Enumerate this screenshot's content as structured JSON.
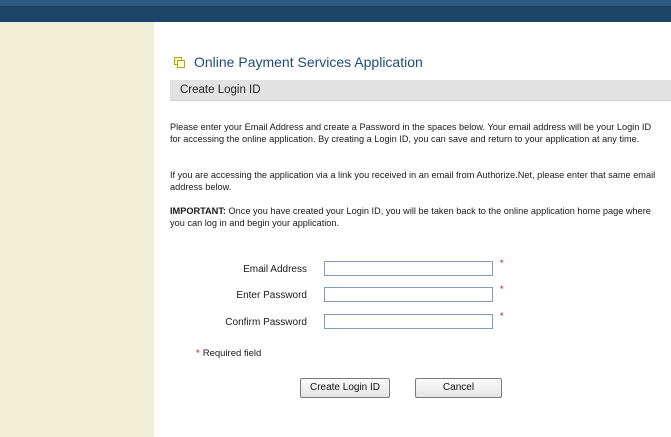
{
  "colors": {
    "top_bar": "#1c4468",
    "sidebar": "#f0efd6",
    "title": "#1f4d78",
    "section_bar": "#e2e2e2",
    "required_star": "#d40000"
  },
  "header": {
    "title": "Online Payment Services Application",
    "icon": "document-copy-icon"
  },
  "section": {
    "title": "Create Login ID"
  },
  "instructions": {
    "para1": "Please enter your Email Address and create a Password in the spaces below. Your email address will be your Login ID for accessing the online application. By creating a Login ID, you can save and return to your application at any time.",
    "para2": "If you are accessing the application via a link you received in an email from Authorize.Net, please enter that same email address below.",
    "para3_bold": "IMPORTANT:",
    "para3_rest": " Once you have created your Login ID, you will be taken back to the online application home page where you can log in and begin your application."
  },
  "form": {
    "fields": [
      {
        "label": "Email Address",
        "value": ""
      },
      {
        "label": "Enter Password",
        "value": ""
      },
      {
        "label": "Confirm Password",
        "value": ""
      }
    ],
    "required_star": "*",
    "required_note": "Required field"
  },
  "buttons": {
    "create": "Create Login ID",
    "cancel": "Cancel"
  }
}
